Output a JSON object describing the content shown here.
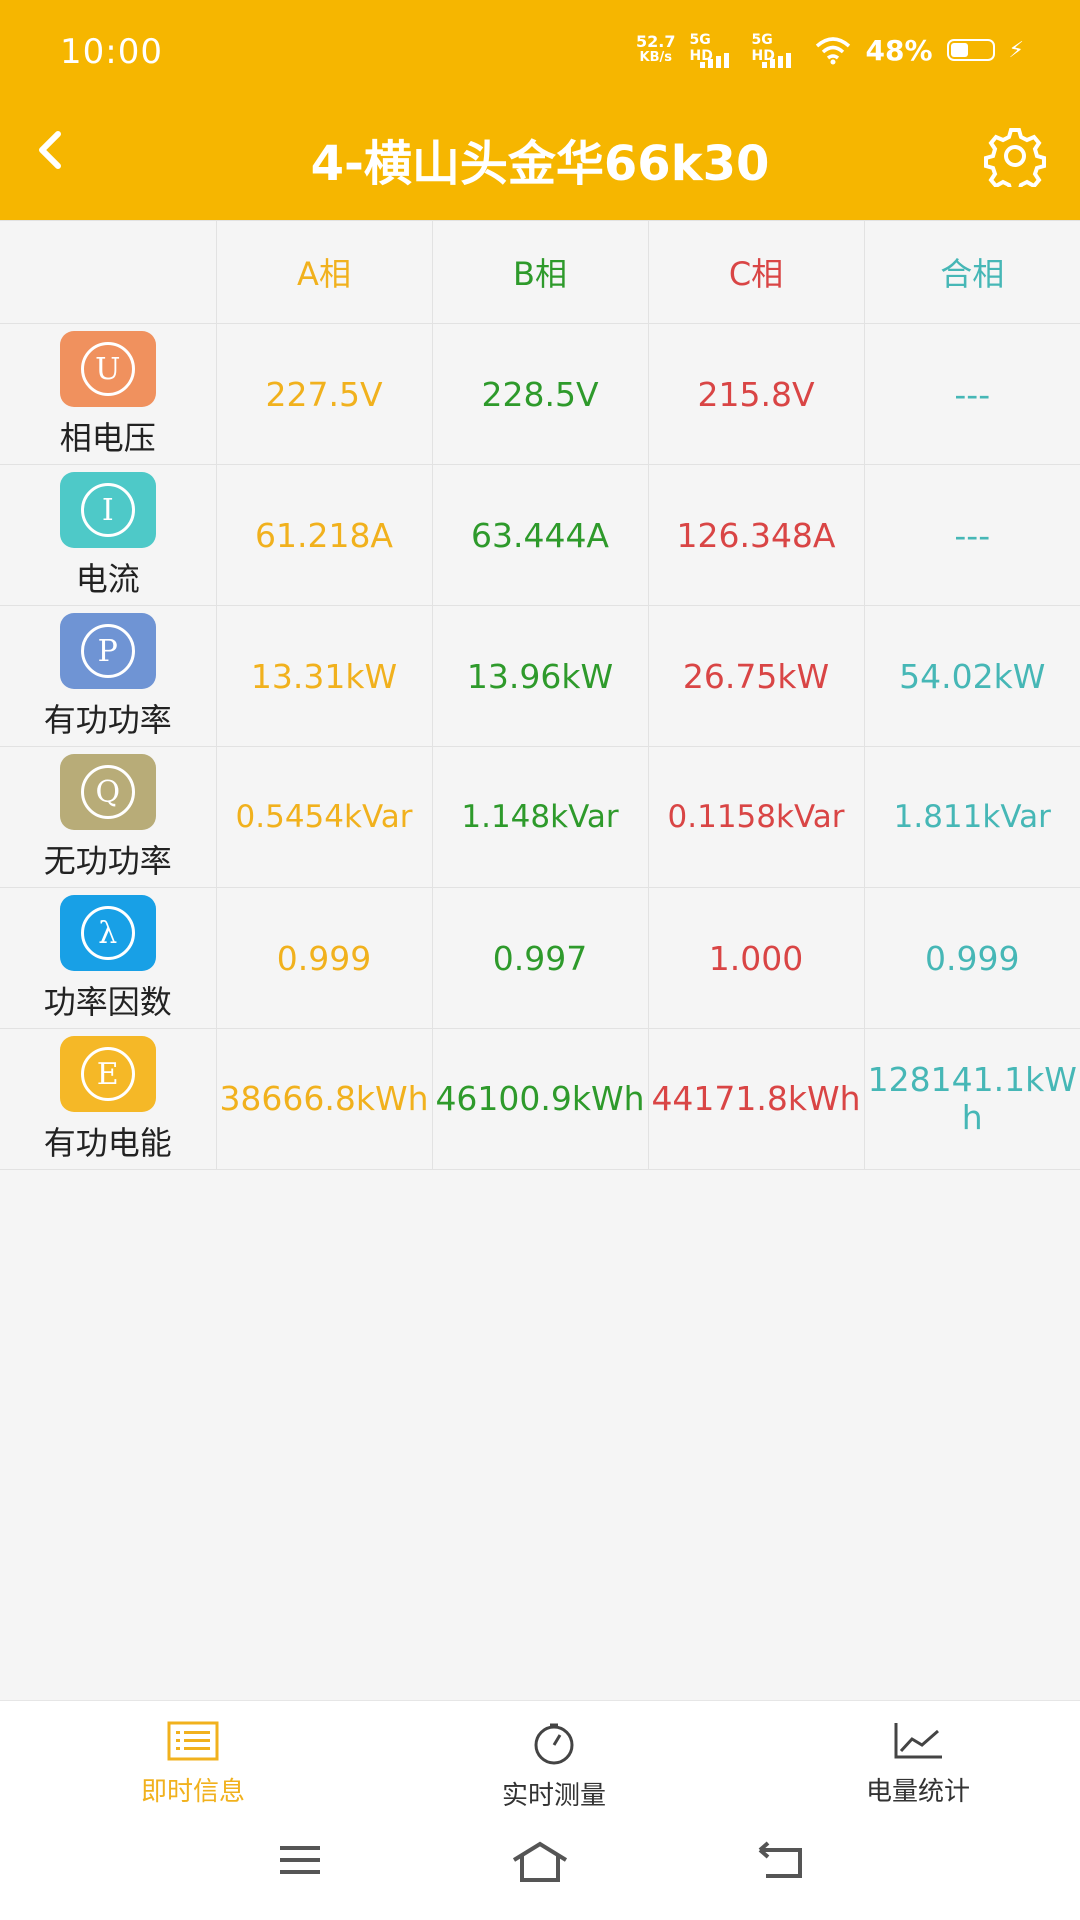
{
  "status": {
    "time": "10:00",
    "net_speed_value": "52.7",
    "net_speed_unit": "KB/s",
    "sim1": "5G HD",
    "sim2": "5G HD",
    "battery": "48%"
  },
  "header": {
    "title": "4-横山头金华66k30",
    "color": "#f6b600"
  },
  "table": {
    "columns": [
      "A相",
      "B相",
      "C相",
      "合相"
    ],
    "rows": [
      {
        "icon": "U",
        "icon_name": "voltage-icon",
        "color": "#f0915e",
        "label": "相电压",
        "values": [
          "227.5V",
          "228.5V",
          "215.8V",
          "---"
        ]
      },
      {
        "icon": "I",
        "icon_name": "current-icon",
        "color": "#4ec9c8",
        "label": "电流",
        "values": [
          "61.218A",
          "63.444A",
          "126.348A",
          "---"
        ]
      },
      {
        "icon": "P",
        "icon_name": "active-power-icon",
        "color": "#6f94d4",
        "label": "有功功率",
        "values": [
          "13.31kW",
          "13.96kW",
          "26.75kW",
          "54.02kW"
        ]
      },
      {
        "icon": "Q",
        "icon_name": "reactive-power-icon",
        "color": "#b8ac78",
        "label": "无功功率",
        "values": [
          "0.5454kVar",
          "1.148kVar",
          "0.1158kVar",
          "1.811kVar"
        ]
      },
      {
        "icon": "λ",
        "icon_name": "power-factor-icon",
        "color": "#18a0e6",
        "label": "功率因数",
        "values": [
          "0.999",
          "0.997",
          "1.000",
          "0.999"
        ]
      },
      {
        "icon": "E",
        "icon_name": "energy-icon",
        "color": "#f5b827",
        "label": "有功电能",
        "values": [
          "38666.8kWh",
          "46100.9kWh",
          "44171.8kWh",
          "128141.1kWh"
        ]
      }
    ],
    "colors": {
      "a": "#f1b11d",
      "b": "#2e9a2b",
      "c": "#d94545",
      "total": "#46b7b6"
    }
  },
  "tabs": [
    {
      "label": "即时信息",
      "icon": "list-icon",
      "active": true,
      "color": "#f1b11d"
    },
    {
      "label": "实时测量",
      "icon": "gauge-icon",
      "active": false,
      "color": "#333333"
    },
    {
      "label": "电量统计",
      "icon": "chart-icon",
      "active": false,
      "color": "#333333"
    }
  ],
  "nav": [
    "menu-icon",
    "home-icon",
    "back-nav-icon"
  ]
}
